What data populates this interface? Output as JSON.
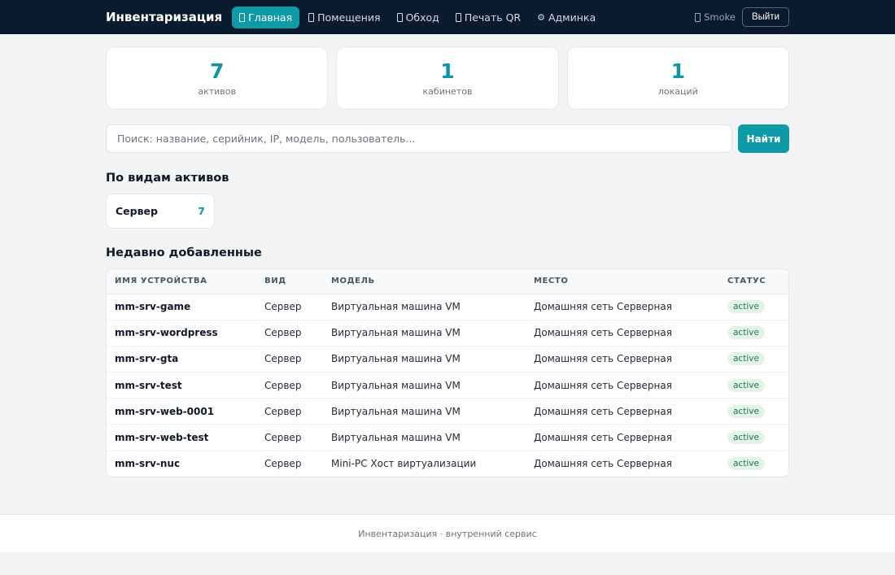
{
  "header": {
    "brand": "Инвентаризация",
    "nav": [
      {
        "label": "Главная",
        "icon": "home-icon",
        "active": true
      },
      {
        "label": "Помещения",
        "icon": "building-icon",
        "active": false
      },
      {
        "label": "Обход",
        "icon": "route-icon",
        "active": false
      },
      {
        "label": "Печать QR",
        "icon": "qr-icon",
        "active": false
      },
      {
        "label": "Админка",
        "icon": "gear-icon",
        "active": false
      }
    ],
    "user": "Smoke",
    "logout_label": "Выйти"
  },
  "stats": [
    {
      "value": "7",
      "label": "активов"
    },
    {
      "value": "1",
      "label": "кабинетов"
    },
    {
      "value": "1",
      "label": "локаций"
    }
  ],
  "search": {
    "placeholder": "Поиск: название, серийник, IP, модель, пользователь...",
    "button_label": "Найти"
  },
  "types": {
    "title": "По видам активов",
    "items": [
      {
        "name": "Сервер",
        "count": "7"
      }
    ]
  },
  "recent": {
    "title": "Недавно добавленные",
    "columns": [
      "Имя устройства",
      "Вид",
      "Модель",
      "Место",
      "Статус"
    ],
    "rows": [
      {
        "name": "mm-srv-game",
        "type": "Сервер",
        "model": "Виртуальная машина VM",
        "place": "Домашняя сеть Серверная",
        "status": "active"
      },
      {
        "name": "mm-srv-wordpress",
        "type": "Сервер",
        "model": "Виртуальная машина VM",
        "place": "Домашняя сеть Серверная",
        "status": "active"
      },
      {
        "name": "mm-srv-gta",
        "type": "Сервер",
        "model": "Виртуальная машина VM",
        "place": "Домашняя сеть Серверная",
        "status": "active"
      },
      {
        "name": "mm-srv-test",
        "type": "Сервер",
        "model": "Виртуальная машина VM",
        "place": "Домашняя сеть Серверная",
        "status": "active"
      },
      {
        "name": "mm-srv-web-0001",
        "type": "Сервер",
        "model": "Виртуальная машина VM",
        "place": "Домашняя сеть Серверная",
        "status": "active"
      },
      {
        "name": "mm-srv-web-test",
        "type": "Сервер",
        "model": "Виртуальная машина VM",
        "place": "Домашняя сеть Серверная",
        "status": "active"
      },
      {
        "name": "mm-srv-nuc",
        "type": "Сервер",
        "model": "Mini-PC Хост виртуализации",
        "place": "Домашняя сеть Серверная",
        "status": "active"
      }
    ]
  },
  "footer": {
    "text": "Инвентаризация · внутренний сервис"
  },
  "colors": {
    "accent": "#0e9aa7",
    "topbar": "#0b1b2f",
    "status_active_bg": "#e3f5ea",
    "status_active_text": "#1e7a43"
  }
}
